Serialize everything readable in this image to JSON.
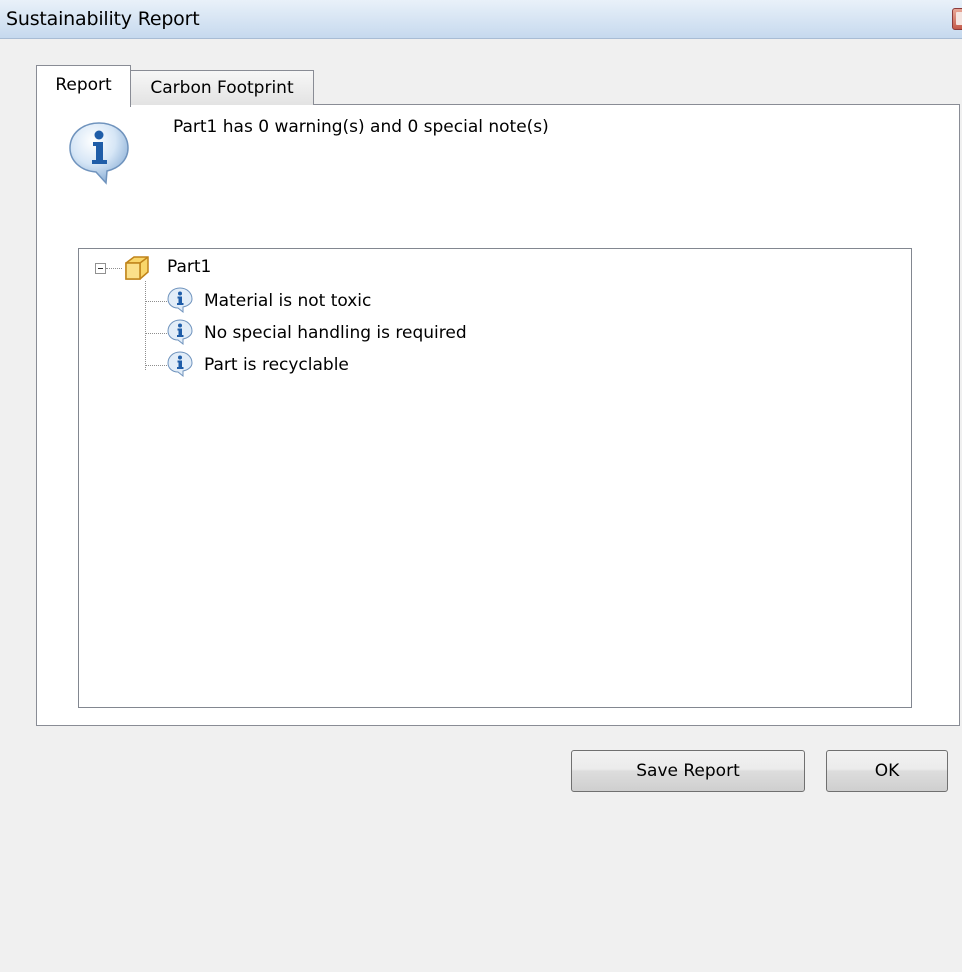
{
  "window": {
    "title": "Sustainability Report"
  },
  "tabs": [
    {
      "label": "Report",
      "active": true
    },
    {
      "label": "Carbon Footprint",
      "active": false
    }
  ],
  "report": {
    "summary": "Part1 has 0 warning(s) and 0 special note(s)",
    "tree": {
      "root": {
        "label": "Part1",
        "icon": "part-cube-icon",
        "expanded": true,
        "children": [
          {
            "label": "Material is not toxic",
            "icon": "info-icon"
          },
          {
            "label": "No special handling is required",
            "icon": "info-icon"
          },
          {
            "label": "Part is recyclable",
            "icon": "info-icon"
          }
        ]
      }
    }
  },
  "buttons": {
    "save_report": "Save Report",
    "ok": "OK"
  },
  "colors": {
    "titlebar": "#c6d9ee",
    "info_icon": "#2a6fb8",
    "part_icon": "#f5c242"
  }
}
